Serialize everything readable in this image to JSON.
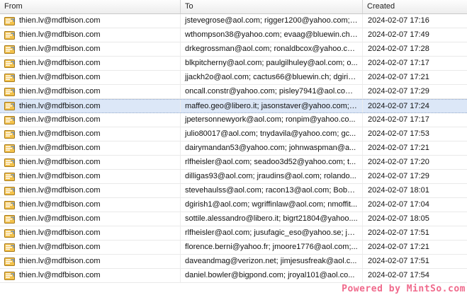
{
  "columns": {
    "from": "From",
    "to": "To",
    "created": "Created"
  },
  "icon": "envelope-icon",
  "selected_index": 6,
  "rows": [
    {
      "from": "thien.lv@mdfbison.com",
      "to": "jstevegrose@aol.com; rigger1200@yahoo.com; ...",
      "created": "2024-02-07 17:16"
    },
    {
      "from": "thien.lv@mdfbison.com",
      "to": "wthompson38@yahoo.com; evaag@bluewin.ch; ...",
      "created": "2024-02-07 17:49"
    },
    {
      "from": "thien.lv@mdfbison.com",
      "to": "drkegrossman@aol.com; ronaldbcox@yahoo.co...",
      "created": "2024-02-07 17:28"
    },
    {
      "from": "thien.lv@mdfbison.com",
      "to": "blkpitcherny@aol.com; paulgilhuley@aol.com; o...",
      "created": "2024-02-07 17:17"
    },
    {
      "from": "thien.lv@mdfbison.com",
      "to": "jjackh2o@aol.com; cactus66@bluewin.ch; dgiris...",
      "created": "2024-02-07 17:21"
    },
    {
      "from": "thien.lv@mdfbison.com",
      "to": "oncall.constr@yahoo.com; pisley7941@aol.com...",
      "created": "2024-02-07 17:29"
    },
    {
      "from": "thien.lv@mdfbison.com",
      "to": "maffeo.geo@libero.it; jasonstaver@yahoo.com; ...",
      "created": "2024-02-07 17:24"
    },
    {
      "from": "thien.lv@mdfbison.com",
      "to": "jpetersonnewyork@aol.com; ronpim@yahoo.co...",
      "created": "2024-02-07 17:17"
    },
    {
      "from": "thien.lv@mdfbison.com",
      "to": "julio80017@aol.com; tnydavila@yahoo.com; gc...",
      "created": "2024-02-07 17:53"
    },
    {
      "from": "thien.lv@mdfbison.com",
      "to": "dairymandan53@yahoo.com; johnwaspman@a...",
      "created": "2024-02-07 17:21"
    },
    {
      "from": "thien.lv@mdfbison.com",
      "to": "rlfheisler@aol.com; seadoo3d52@yahoo.com; t...",
      "created": "2024-02-07 17:20"
    },
    {
      "from": "thien.lv@mdfbison.com",
      "to": "dilligas93@aol.com; jraudins@aol.com; rolando...",
      "created": "2024-02-07 17:29"
    },
    {
      "from": "thien.lv@mdfbison.com",
      "to": "stevehaulss@aol.com; racon13@aol.com; Bobb...",
      "created": "2024-02-07 18:01"
    },
    {
      "from": "thien.lv@mdfbison.com",
      "to": "dgirish1@aol.com; wgriffinlaw@aol.com; nmoffit...",
      "created": "2024-02-07 17:04"
    },
    {
      "from": "thien.lv@mdfbison.com",
      "to": "sottile.alessandro@libero.it; bigrt21804@yahoo....",
      "created": "2024-02-07 18:05"
    },
    {
      "from": "thien.lv@mdfbison.com",
      "to": "rlfheisler@aol.com; jusufagic_eso@yahoo.se; jp...",
      "created": "2024-02-07 17:51"
    },
    {
      "from": "thien.lv@mdfbison.com",
      "to": "florence.berni@yahoo.fr; jmoore1776@aol.com;...",
      "created": "2024-02-07 17:21"
    },
    {
      "from": "thien.lv@mdfbison.com",
      "to": "daveandmag@verizon.net; jimjesusfreak@aol.c...",
      "created": "2024-02-07 17:51"
    },
    {
      "from": "thien.lv@mdfbison.com",
      "to": "daniel.bowler@bigpond.com; jroyal101@aol.co...",
      "created": "2024-02-07 17:54"
    }
  ],
  "watermark": "Powered by MintSo.com"
}
